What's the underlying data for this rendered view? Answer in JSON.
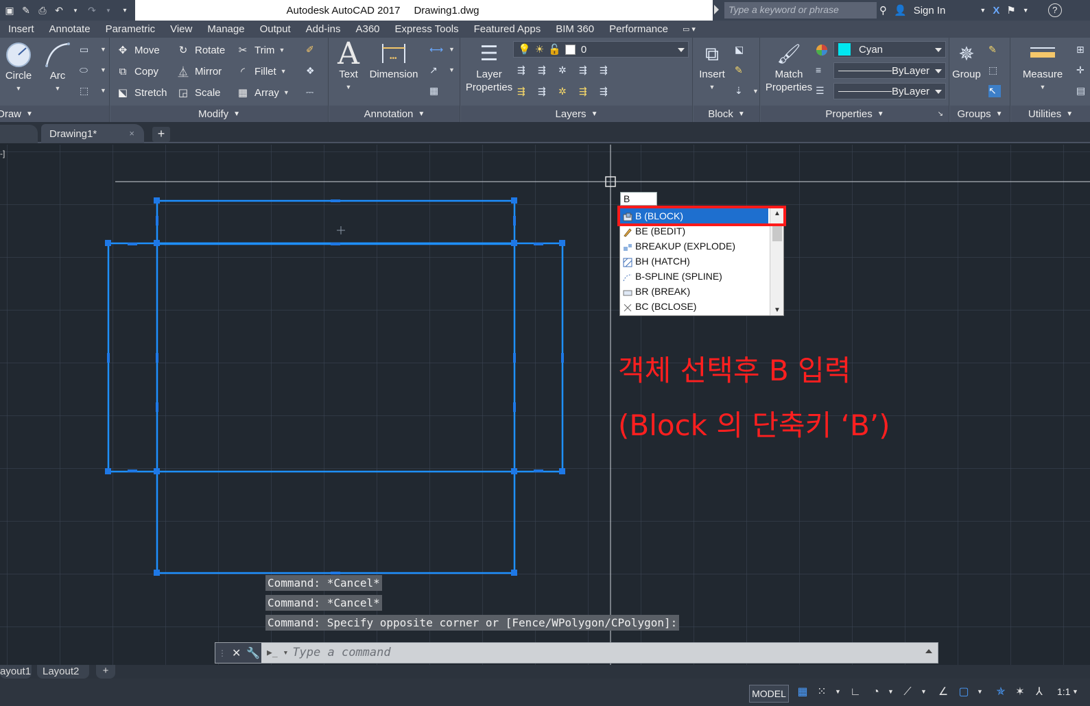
{
  "window": {
    "app_title": "Autodesk AutoCAD 2017",
    "file_name": "Drawing1.dwg",
    "search_placeholder": "Type a keyword or phrase",
    "sign_in": "Sign In"
  },
  "menu": [
    "Insert",
    "Annotate",
    "Parametric",
    "View",
    "Manage",
    "Output",
    "Add-ins",
    "A360",
    "Express Tools",
    "Featured Apps",
    "BIM 360",
    "Performance"
  ],
  "ribbon": {
    "draw": {
      "title": "Draw",
      "circle": "Circle",
      "arc": "Arc"
    },
    "modify": {
      "title": "Modify",
      "move": "Move",
      "rotate": "Rotate",
      "trim": "Trim",
      "copy": "Copy",
      "mirror": "Mirror",
      "fillet": "Fillet",
      "stretch": "Stretch",
      "scale": "Scale",
      "array": "Array"
    },
    "annotation": {
      "title": "Annotation",
      "text": "Text",
      "dimension": "Dimension"
    },
    "layers": {
      "title": "Layers",
      "layer_props_1": "Layer",
      "layer_props_2": "Properties",
      "current_layer": "0"
    },
    "block": {
      "title": "Block",
      "insert": "Insert"
    },
    "properties": {
      "title": "Properties",
      "match_1": "Match",
      "match_2": "Properties",
      "color": "Cyan",
      "color_hex": "#00e6f0",
      "linetype": "ByLayer",
      "lineweight": "ByLayer"
    },
    "groups": {
      "title": "Groups",
      "group": "Group"
    },
    "utilities": {
      "title": "Utilities",
      "measure": "Measure"
    }
  },
  "doc_tabs": {
    "active": "Drawing1*",
    "close": "×",
    "add": "+"
  },
  "viewport": {
    "label": "-]",
    "typed_input": "B",
    "autocomplete": [
      {
        "text": "B (BLOCK)",
        "icon": "block-icon",
        "selected": true
      },
      {
        "text": "BE (BEDIT)",
        "icon": "bedit-icon",
        "selected": false
      },
      {
        "text": "BREAKUP (EXPLODE)",
        "icon": "explode-icon",
        "selected": false
      },
      {
        "text": "BH (HATCH)",
        "icon": "hatch-icon",
        "selected": false
      },
      {
        "text": "B-SPLINE (SPLINE)",
        "icon": "spline-icon",
        "selected": false
      },
      {
        "text": "BR (BREAK)",
        "icon": "break-icon",
        "selected": false
      },
      {
        "text": "BC (BCLOSE)",
        "icon": "bclose-icon",
        "selected": false
      }
    ],
    "annotation_line1": "객체 선택후 B 입력",
    "annotation_line2": "(Block 의 단축키 ‘B’)",
    "annotation_color": "#ff1f1f",
    "selection_color": "#1e90ff"
  },
  "command": {
    "history": [
      "Command: *Cancel*",
      "Command: *Cancel*",
      "Command: Specify opposite corner or [Fence/WPolygon/CPolygon]:"
    ],
    "placeholder": "Type a command"
  },
  "layout_tabs": [
    "ayout1",
    "Layout2",
    "+"
  ],
  "status": {
    "model": "MODEL",
    "scale": "1:1"
  }
}
